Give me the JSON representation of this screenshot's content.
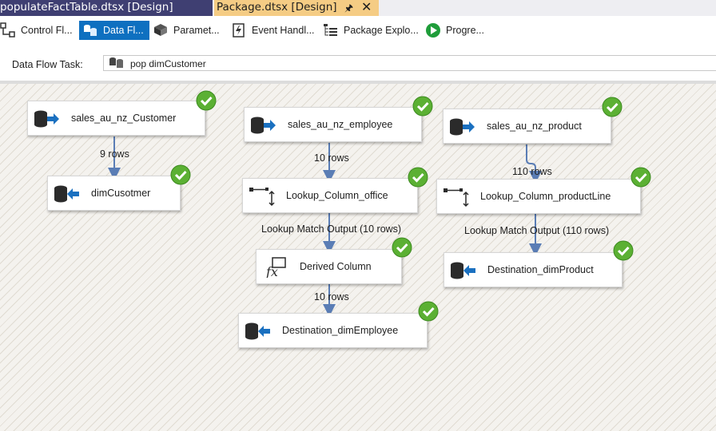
{
  "doc_tabs": {
    "inactive": "populateFactTable.dtsx [Design]",
    "active": "Package.dtsx [Design]",
    "pin_icon": "pin-icon",
    "close_icon": "close-icon"
  },
  "designer_tabs": [
    {
      "label": "Control Fl...",
      "icon": "control-flow-icon"
    },
    {
      "label": "Data Fl...",
      "icon": "data-flow-icon",
      "selected": true
    },
    {
      "label": "Paramet...",
      "icon": "parameters-icon"
    },
    {
      "label": "Event Handl...",
      "icon": "event-handlers-icon"
    },
    {
      "label": "Package Explo...",
      "icon": "package-explorer-icon"
    },
    {
      "label": "Progre...",
      "icon": "progress-icon"
    }
  ],
  "task": {
    "label": "Data Flow Task:",
    "value": "pop  dimCustomer"
  },
  "components": {
    "sales_customer": "sales_au_nz_Customer",
    "dim_cusotmer": "dimCusotmer",
    "sales_employee": "sales_au_nz_employee",
    "lookup_office": "Lookup_Column_office",
    "derived_column": "Derived Column",
    "dest_employee": "Destination_dimEmployee",
    "sales_product": "sales_au_nz_product",
    "lookup_productline": "Lookup_Column_productLine",
    "dest_product": "Destination_dimProduct"
  },
  "flows": {
    "customer_rows": "9 rows",
    "employee_rows": "10 rows",
    "lookup_office_output": "Lookup Match Output (10 rows)",
    "derived_rows": "10 rows",
    "product_rows": "110 rows",
    "lookup_productline_output": "Lookup Match Output (110 rows)"
  },
  "colors": {
    "status_success": "#5bb033",
    "connector": "#5a7db5",
    "selected_tab": "#0e70c0",
    "active_doc_tab": "#f5cc84",
    "inactive_doc_tab": "#3f3f72"
  }
}
